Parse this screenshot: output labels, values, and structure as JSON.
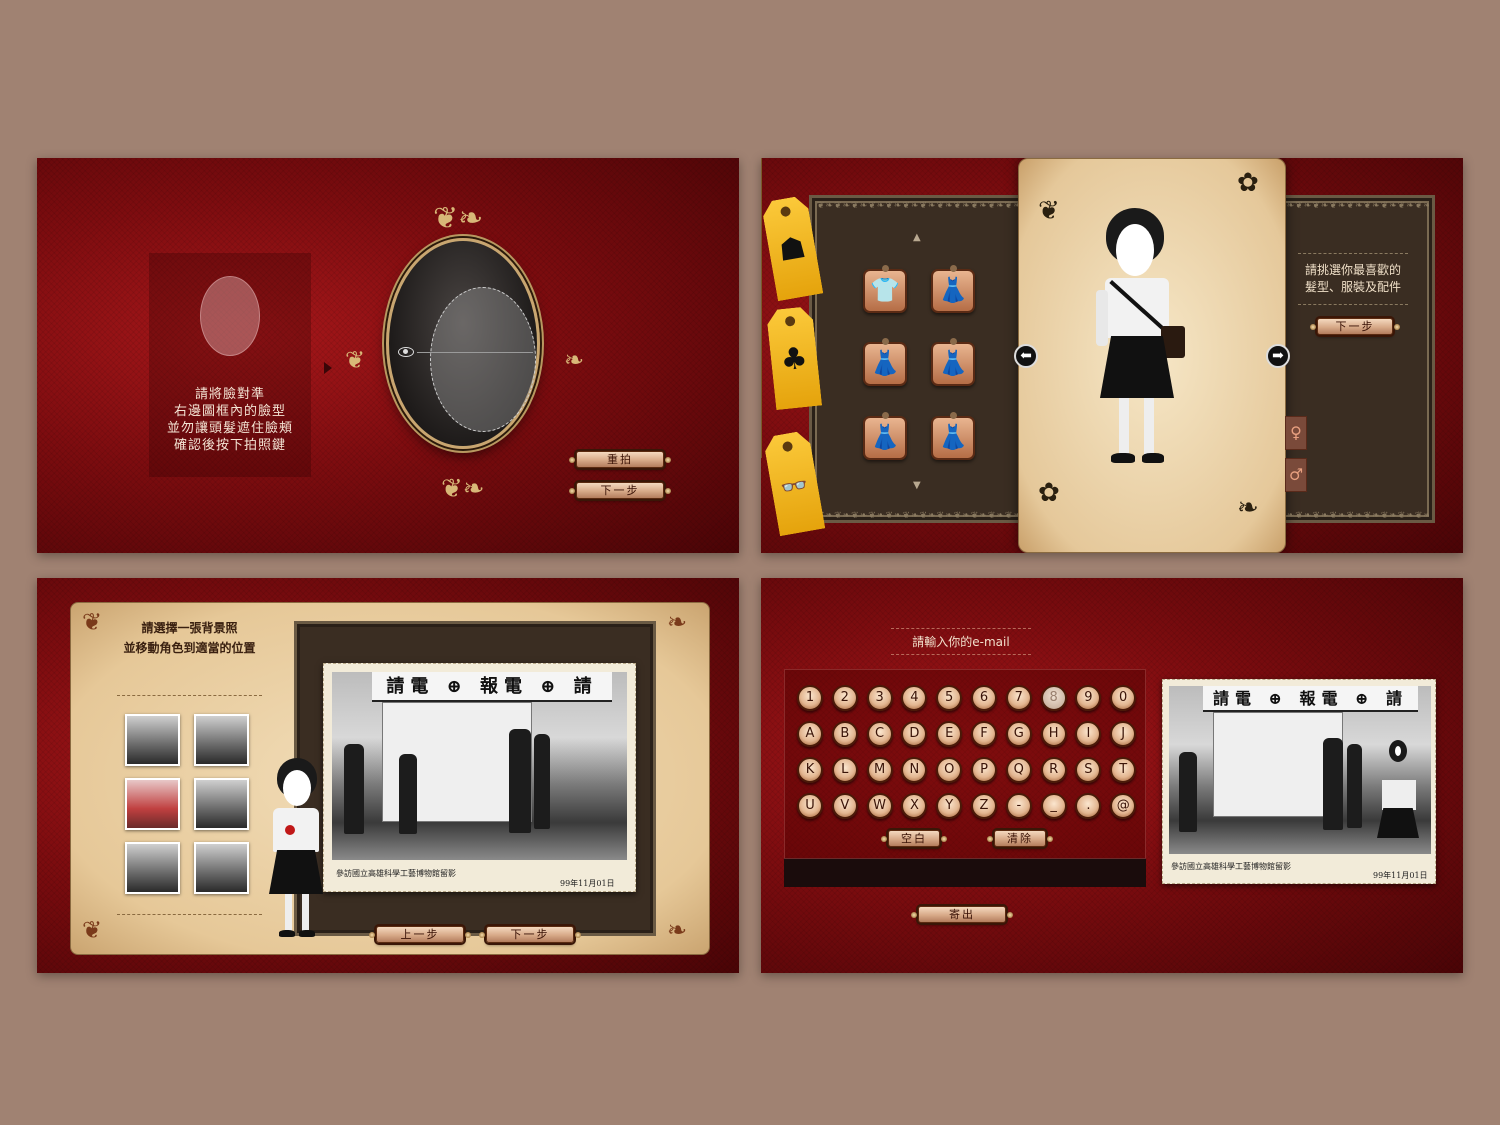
{
  "screen1": {
    "instructions": [
      "請將臉對準",
      "右邊圖框內的臉型",
      "並勿讓頭髮遮住臉頰",
      "確認後按下拍照鍵"
    ],
    "retake_label": "重拍",
    "next_label": "下一步"
  },
  "screen2": {
    "tags": [
      {
        "icon": "hair-icon",
        "glyph": "☗"
      },
      {
        "icon": "clothes-icon",
        "glyph": "♣"
      },
      {
        "icon": "glasses-icon",
        "glyph": "👓"
      }
    ],
    "clothes": [
      {
        "icon": "blouse-skirt-icon",
        "glyph": "👕"
      },
      {
        "icon": "qipao-icon",
        "glyph": "👗"
      },
      {
        "icon": "floral-dress-icon",
        "glyph": "👗"
      },
      {
        "icon": "dark-qipao-icon",
        "glyph": "👗"
      },
      {
        "icon": "plaid-dress-icon",
        "glyph": "👗"
      },
      {
        "icon": "white-dress-icon",
        "glyph": "👗"
      }
    ],
    "prompt_lines": [
      "請挑選你最喜歡的",
      "髮型、服裝及配件"
    ],
    "next_label": "下一步",
    "prev_arrow": "⬅",
    "next_arrow": "➡",
    "gender_glyphs": [
      "♀",
      "♂"
    ]
  },
  "screen3": {
    "prompt_lines": [
      "請選擇一張背景照",
      "並移動角色到適當的位置"
    ],
    "sign_text": "請電 ⊕ 報電 ⊕ 請",
    "caption": "參訪國立高雄科學工藝博物館留影",
    "date": "99年11月01日",
    "prev_label": "上一步",
    "next_label": "下一步"
  },
  "screen4": {
    "email_title": "請輸入你的e-mail",
    "keys_row1": [
      "1",
      "2",
      "3",
      "4",
      "5",
      "6",
      "7",
      "8",
      "9",
      "0"
    ],
    "keys_row2": [
      "A",
      "B",
      "C",
      "D",
      "E",
      "F",
      "G",
      "H",
      "I",
      "J"
    ],
    "keys_row3": [
      "K",
      "L",
      "M",
      "N",
      "O",
      "P",
      "Q",
      "R",
      "S",
      "T"
    ],
    "keys_row4": [
      "U",
      "V",
      "W",
      "X",
      "Y",
      "Z",
      "-",
      "_",
      ".",
      "@"
    ],
    "space_label": "空白",
    "clear_label": "清除",
    "send_label": "寄出",
    "sign_text": "請電 ⊕ 報電 ⊕ 請",
    "caption": "參訪國立高雄科學工藝博物館留影",
    "date": "99年11月01日"
  },
  "colors": {
    "background": "#a08272",
    "screen_red": "#8a0f12",
    "tag_yellow": "#f5b51f",
    "parchment": "#ecd4a8"
  }
}
